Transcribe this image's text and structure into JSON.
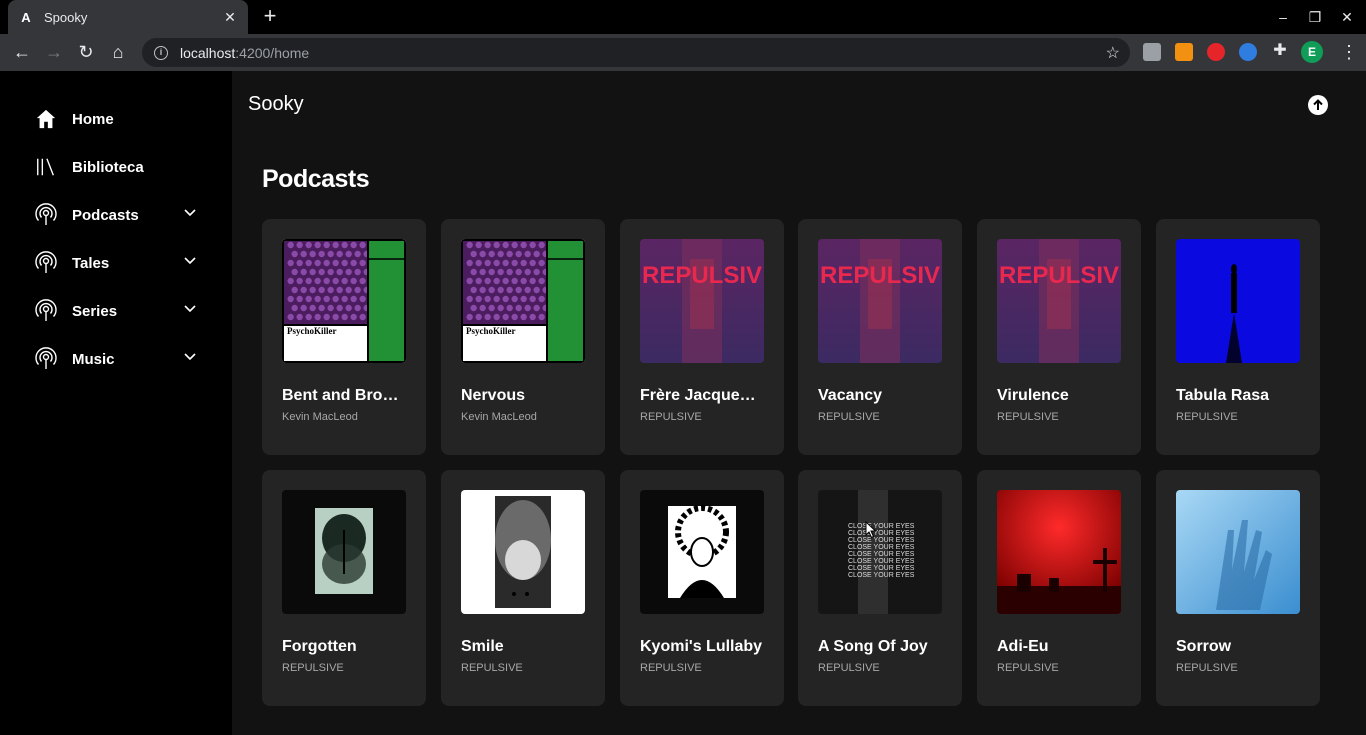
{
  "browser": {
    "tab_title": "Spooky",
    "tab_favicon": "A",
    "url_host": "localhost",
    "url_path": ":4200/home",
    "profile_initial": "E"
  },
  "app": {
    "brand": "Sooky",
    "section_title": "Podcasts"
  },
  "sidebar": {
    "items": [
      {
        "label": "Home",
        "icon": "home-icon"
      },
      {
        "label": "Biblioteca",
        "icon": "library-icon"
      },
      {
        "label": "Podcasts",
        "icon": "podcast-icon",
        "expandable": true
      },
      {
        "label": "Tales",
        "icon": "podcast-icon",
        "expandable": true
      },
      {
        "label": "Series",
        "icon": "podcast-icon",
        "expandable": true
      },
      {
        "label": "Music",
        "icon": "podcast-icon",
        "expandable": true
      }
    ]
  },
  "cards": [
    {
      "title": "Bent and Bro…",
      "artist": "Kevin MacLeod",
      "art": "psychokiller",
      "art_text": "PsychoKiller"
    },
    {
      "title": "Nervous",
      "artist": "Kevin MacLeod",
      "art": "psychokiller",
      "art_text": "PsychoKiller"
    },
    {
      "title": "Frère Jacque…",
      "artist": "REPULSIVE",
      "art": "repulsiv",
      "art_text": "REPULSIV"
    },
    {
      "title": "Vacancy",
      "artist": "REPULSIVE",
      "art": "repulsiv",
      "art_text": "REPULSIV"
    },
    {
      "title": "Virulence",
      "artist": "REPULSIVE",
      "art": "repulsiv",
      "art_text": "REPULSIV"
    },
    {
      "title": "Tabula Rasa",
      "artist": "REPULSIVE",
      "art": "blue-figure"
    },
    {
      "title": "Forgotten",
      "artist": "REPULSIVE",
      "art": "trees"
    },
    {
      "title": "Smile",
      "artist": "REPULSIVE",
      "art": "sketch"
    },
    {
      "title": "Kyomi's Lullaby",
      "artist": "REPULSIVE",
      "art": "medusa"
    },
    {
      "title": "A Song Of Joy",
      "artist": "REPULSIVE",
      "art": "close-your-eyes",
      "art_text": "CLOSE YOUR EYES"
    },
    {
      "title": "Adi-Eu",
      "artist": "REPULSIVE",
      "art": "red-cemetery"
    },
    {
      "title": "Sorrow",
      "artist": "REPULSIVE",
      "art": "blue-hands"
    }
  ],
  "colors": {
    "sidebar_bg": "#000000",
    "main_bg": "#121212",
    "card_bg": "#242424",
    "subtext": "#a7a7a7",
    "repulsiv_red": "#e8284f"
  }
}
